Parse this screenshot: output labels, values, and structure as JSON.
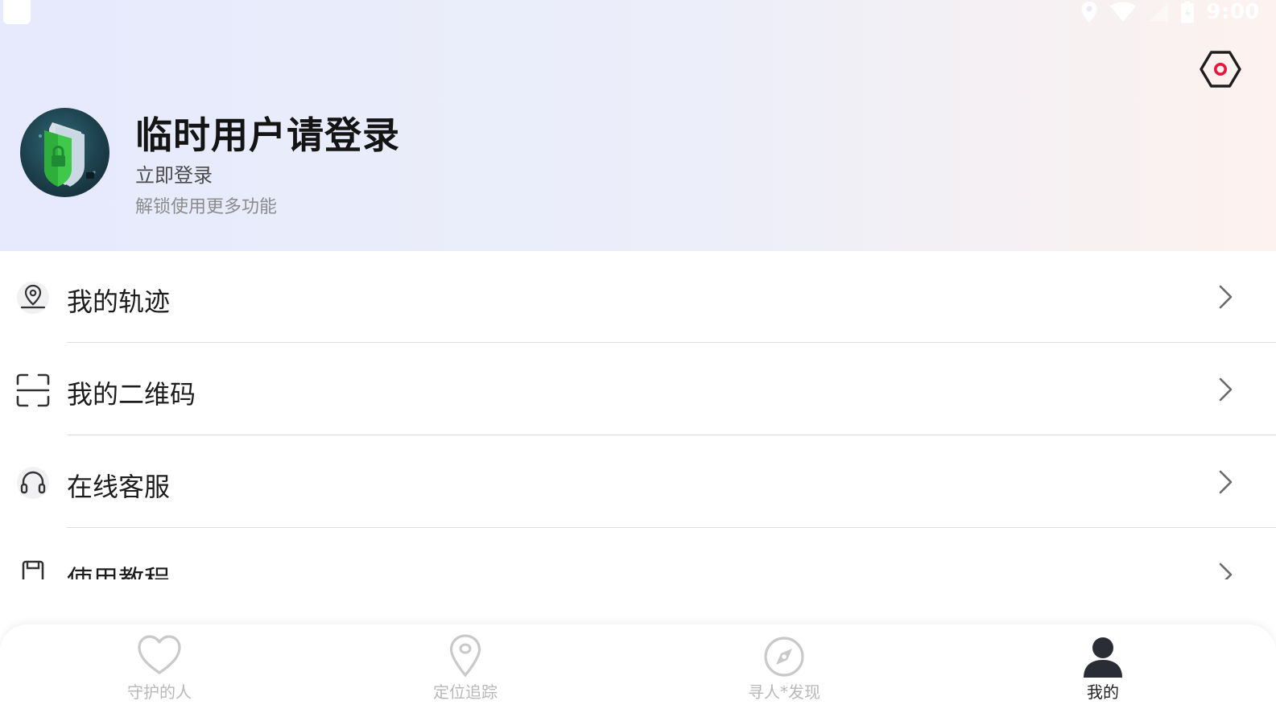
{
  "status_bar": {
    "time": "9:00",
    "icons": [
      "location-icon",
      "wifi-icon",
      "signal-icon",
      "battery-icon"
    ]
  },
  "header": {
    "title": "临时用户请登录",
    "login_link": "立即登录",
    "subtitle": "解锁使用更多功能",
    "settings_icon": "settings-hexagon-icon",
    "accent_color": "#e8163c"
  },
  "menu": {
    "items": [
      {
        "label": "我的轨迹",
        "icon": "track-pin-icon"
      },
      {
        "label": "我的二维码",
        "icon": "qr-scan-icon"
      },
      {
        "label": "在线客服",
        "icon": "headset-icon"
      },
      {
        "label": "使用教程",
        "icon": "tutorial-doc-icon"
      }
    ]
  },
  "tabbar": {
    "tabs": [
      {
        "label": "守护的人",
        "icon": "heart-icon",
        "active": false
      },
      {
        "label": "定位追踪",
        "icon": "location-pin-icon",
        "active": false
      },
      {
        "label": "寻人*发现",
        "icon": "compass-icon",
        "active": false
      },
      {
        "label": "我的",
        "icon": "user-icon",
        "active": true
      }
    ]
  }
}
